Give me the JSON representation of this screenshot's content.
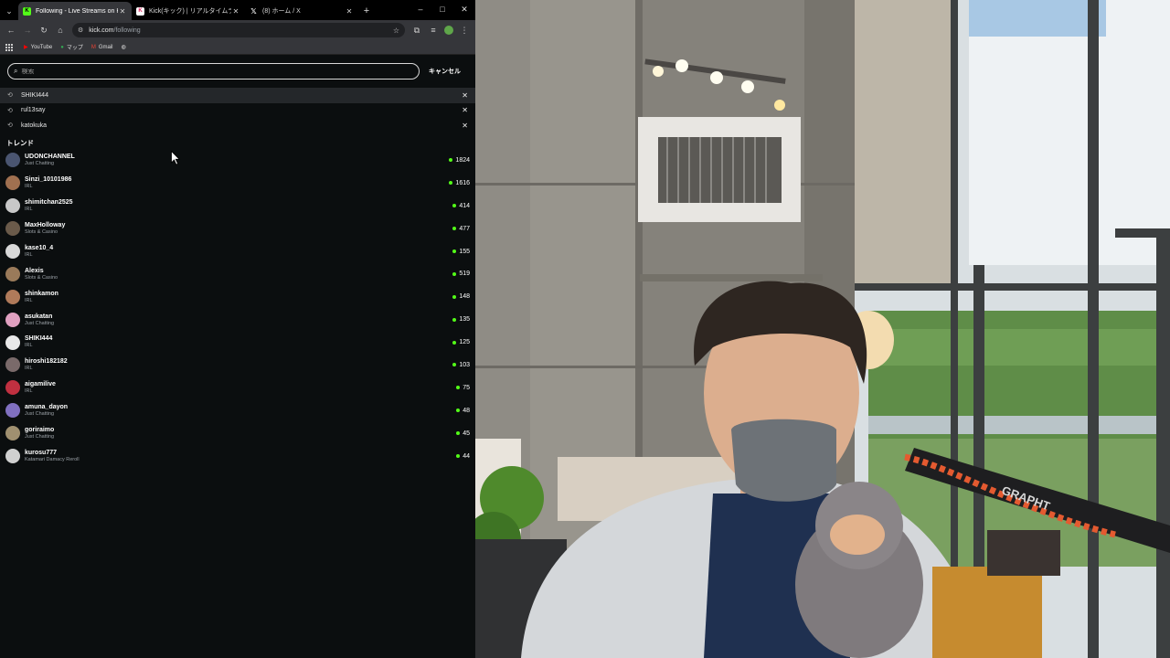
{
  "browser": {
    "tabs": [
      {
        "title": "Following - Live Streams on Kick",
        "active": true
      },
      {
        "title": "Kick(キック) | リアルタイムランキング",
        "active": false
      },
      {
        "title": "(8) ホーム / X",
        "active": false
      }
    ],
    "new_tab": "+",
    "window_controls": {
      "minimize": "–",
      "maximize": "□",
      "close": "✕"
    },
    "address": {
      "host": "kick.com",
      "path": "/following"
    },
    "bookmarks": [
      {
        "label": "YouTube"
      },
      {
        "label": "マップ"
      },
      {
        "label": "Gmail"
      }
    ]
  },
  "search": {
    "placeholder": "検索",
    "cancel_label": "キャンセル"
  },
  "recent_searches": [
    {
      "query": "SHIKI444",
      "remove": "✕"
    },
    {
      "query": "rul13say",
      "remove": "✕"
    },
    {
      "query": "katokuka",
      "remove": "✕"
    }
  ],
  "trend_title": "トレンド",
  "trends": [
    {
      "name": "UDONCHANNEL",
      "category": "Just Chatting",
      "viewers": "1824",
      "avatar_color": "#4a5570"
    },
    {
      "name": "Sinzi_10101986",
      "category": "IRL",
      "viewers": "1616",
      "avatar_color": "#a07050"
    },
    {
      "name": "shimitchan2525",
      "category": "IRL",
      "viewers": "414",
      "avatar_color": "#c8c8c8"
    },
    {
      "name": "MaxHolloway",
      "category": "Slots & Casino",
      "viewers": "477",
      "avatar_color": "#6a5a4a"
    },
    {
      "name": "kase10_4",
      "category": "IRL",
      "viewers": "155",
      "avatar_color": "#d8d8d8"
    },
    {
      "name": "Alexis",
      "category": "Slots & Casino",
      "viewers": "519",
      "avatar_color": "#9a7a5a"
    },
    {
      "name": "shinkamon",
      "category": "IRL",
      "viewers": "148",
      "avatar_color": "#b07a5a"
    },
    {
      "name": "asukatan",
      "category": "Just Chatting",
      "viewers": "135",
      "avatar_color": "#e0a0c0"
    },
    {
      "name": "SHIKI444",
      "category": "IRL",
      "viewers": "125",
      "avatar_color": "#e8e8e8"
    },
    {
      "name": "hiroshi182182",
      "category": "IRL",
      "viewers": "103",
      "avatar_color": "#7a6a6a"
    },
    {
      "name": "aigamilive",
      "category": "IRL",
      "viewers": "75",
      "avatar_color": "#c03040"
    },
    {
      "name": "amuna_dayon",
      "category": "Just Chatting",
      "viewers": "48",
      "avatar_color": "#8070c0"
    },
    {
      "name": "goriraimo",
      "category": "Just Chatting",
      "viewers": "45",
      "avatar_color": "#a09070"
    },
    {
      "name": "kurosu777",
      "category": "Katamari Damacy Reroll",
      "viewers": "44",
      "avatar_color": "#d0d0d0"
    }
  ],
  "webcam": {
    "device_brand": "GRAPHT",
    "colors": {
      "concrete": "#8f8c85",
      "window": "#dfe6ea",
      "greenery": "#5f8d48"
    }
  }
}
